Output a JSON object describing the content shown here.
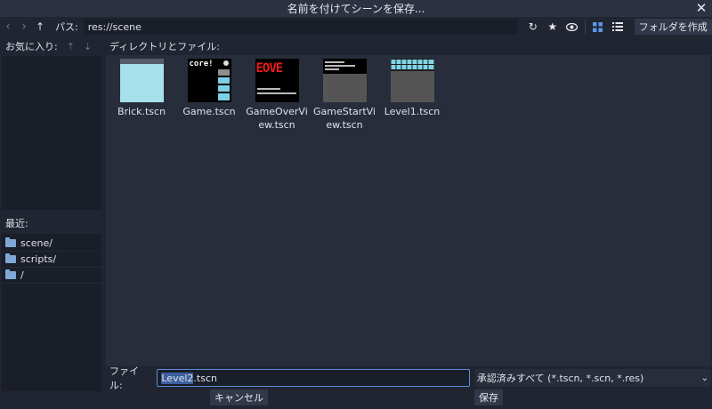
{
  "window": {
    "title": "名前を付けてシーンを保存..."
  },
  "pathbar": {
    "label": "パス:",
    "path": "res://scene",
    "new_folder_label": "フォルダを作成"
  },
  "favorites": {
    "label": "お気に入り:"
  },
  "recent": {
    "label": "最近:",
    "items": [
      {
        "label": "scene/"
      },
      {
        "label": "scripts/"
      },
      {
        "label": "/"
      }
    ]
  },
  "files": {
    "label": "ディレクトリとファイル:",
    "items": [
      {
        "name": "Brick.tscn"
      },
      {
        "name": "Game.tscn",
        "thumb_text": "core!"
      },
      {
        "name": "GameOverView.tscn",
        "thumb_text": "EOVE"
      },
      {
        "name": "GameStartView.tscn"
      },
      {
        "name": "Level1.tscn"
      }
    ]
  },
  "footer": {
    "file_label": "ファイル:",
    "file_selected": "Level2",
    "file_rest": ".tscn",
    "filter": "承認済みすべて (*.tscn, *.scn, *.res)"
  },
  "buttons": {
    "cancel": "キャンセル",
    "save": "保存"
  },
  "colors": {
    "accent": "#5c97ea",
    "background": "#202531",
    "panel": "#272d3a"
  }
}
